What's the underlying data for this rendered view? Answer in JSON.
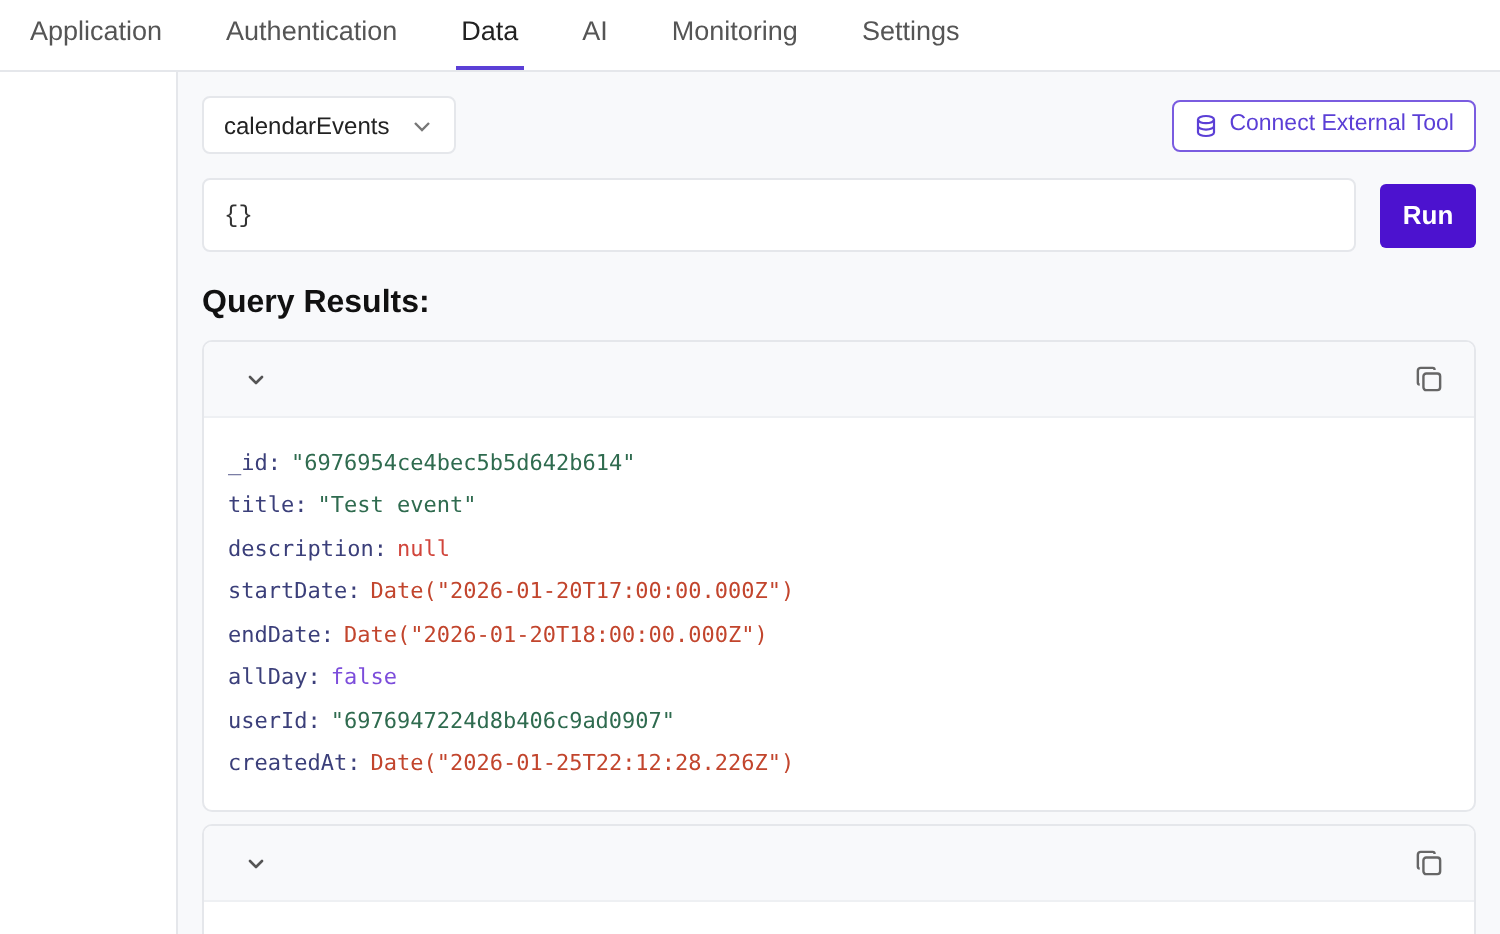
{
  "tabs": [
    {
      "label": "Application",
      "selected": false
    },
    {
      "label": "Authentication",
      "selected": false
    },
    {
      "label": "Data",
      "selected": true
    },
    {
      "label": "AI",
      "selected": false
    },
    {
      "label": "Monitoring",
      "selected": false
    },
    {
      "label": "Settings",
      "selected": false
    }
  ],
  "collection_select": {
    "value": "calendarEvents"
  },
  "connect_button": {
    "label": "Connect External Tool"
  },
  "query_field": {
    "value": "{}"
  },
  "run_button": {
    "label": "Run"
  },
  "results_heading": "Query Results:",
  "documents": [
    {
      "expanded": true,
      "fields": [
        {
          "key": "_id:",
          "value": "\"6976954ce4bec5b5d642b614\"",
          "kind": "string"
        },
        {
          "key": "title:",
          "value": "\"Test event\"",
          "kind": "string"
        },
        {
          "key": "description:",
          "value": "null",
          "kind": "null"
        },
        {
          "key": "startDate:",
          "value": "Date(\"2026-01-20T17:00:00.000Z\")",
          "kind": "date"
        },
        {
          "key": "endDate:",
          "value": "Date(\"2026-01-20T18:00:00.000Z\")",
          "kind": "date"
        },
        {
          "key": "allDay:",
          "value": "false",
          "kind": "boolean"
        },
        {
          "key": "userId:",
          "value": "\"6976947224d8b406c9ad0907\"",
          "kind": "string"
        },
        {
          "key": "createdAt:",
          "value": "Date(\"2026-01-25T22:12:28.226Z\")",
          "kind": "date"
        }
      ]
    },
    {
      "expanded": true
    }
  ]
}
